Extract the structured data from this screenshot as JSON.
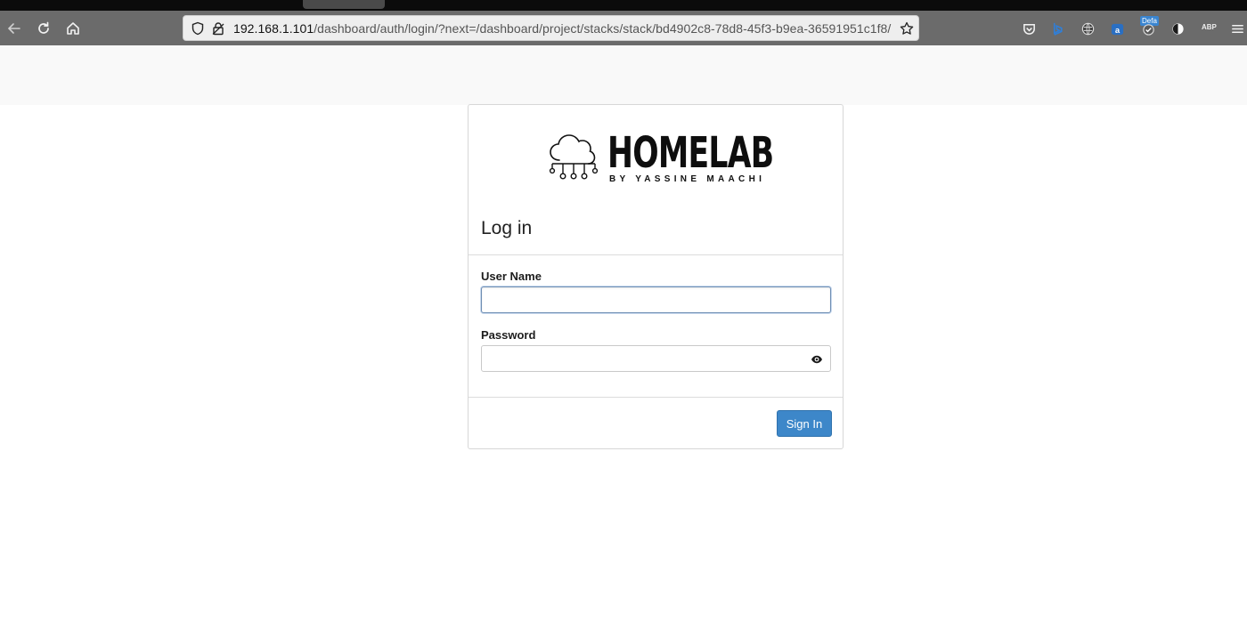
{
  "browser": {
    "url_host": "192.168.1.101",
    "url_path": "/dashboard/auth/login/?next=/dashboard/project/stacks/stack/bd4902c8-78d8-45f3-b9ea-36591951c1f8/",
    "nav_icons": [
      "back-icon",
      "reload-icon",
      "home-icon"
    ],
    "urlbar_icons": [
      "tracking-shield-icon",
      "lock-icon",
      "bookmark-star-icon"
    ],
    "extensions": {
      "items": [
        "pocket-icon",
        "bing-icon",
        "globe-icon",
        "translate-icon",
        "adblock-icon",
        "vpn-icon"
      ],
      "badge_text": "Defa",
      "abp_label": "ABP",
      "menu_icon": "hamburger-menu-icon"
    }
  },
  "login": {
    "logo": {
      "brand": "HOMELAB",
      "byline": "BY YASSINE MAACHI",
      "icon": "cloud-network-icon"
    },
    "title": "Log in",
    "username": {
      "label": "User Name",
      "value": "",
      "placeholder": ""
    },
    "password": {
      "label": "Password",
      "value": "",
      "placeholder": "",
      "toggle_icon": "eye-icon"
    },
    "submit_label": "Sign In"
  },
  "colors": {
    "primary_button": "#3d87c9",
    "toolbar": "#6b6b6b",
    "tabstrip": "#0b0b0b"
  }
}
